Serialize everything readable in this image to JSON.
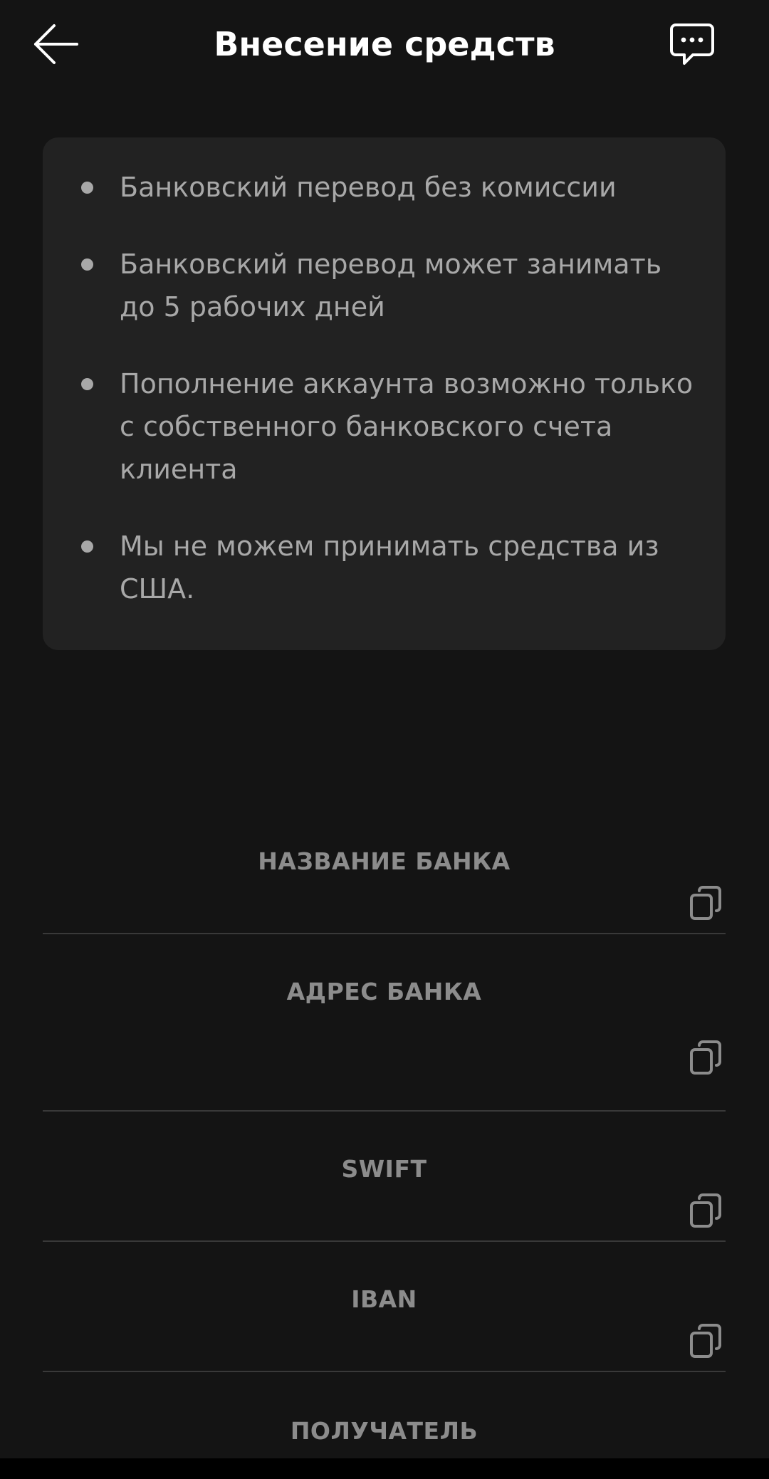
{
  "header": {
    "title": "Внесение средств",
    "back_icon": "arrow-left-icon",
    "chat_icon": "chat-dots-icon"
  },
  "info": {
    "items": [
      {
        "text": "Банковский перевод без комиссии"
      },
      {
        "text": "Банковский перевод может занимать до 5 рабочих дней"
      },
      {
        "text": "Пополнение аккаунта возможно только с собственного банковского счета клиента"
      },
      {
        "text": "Мы не можем принимать средства из США."
      }
    ]
  },
  "fields": [
    {
      "label": "НАЗВАНИЕ БАНКА",
      "value": "",
      "icon": "copy-icon"
    },
    {
      "label": "АДРЕС БАНКА",
      "value": "",
      "icon": "copy-icon"
    },
    {
      "label": "SWIFT",
      "value": "",
      "icon": "copy-icon"
    },
    {
      "label": "IBAN",
      "value": "",
      "icon": "copy-icon"
    },
    {
      "label": "ПОЛУЧАТЕЛЬ",
      "value": ""
    }
  ],
  "colors": {
    "background": "#141414",
    "card": "#222222",
    "title": "#ffffff",
    "body_text": "#a8a8a8",
    "label_text": "#8c8c8c",
    "divider": "#393939"
  }
}
